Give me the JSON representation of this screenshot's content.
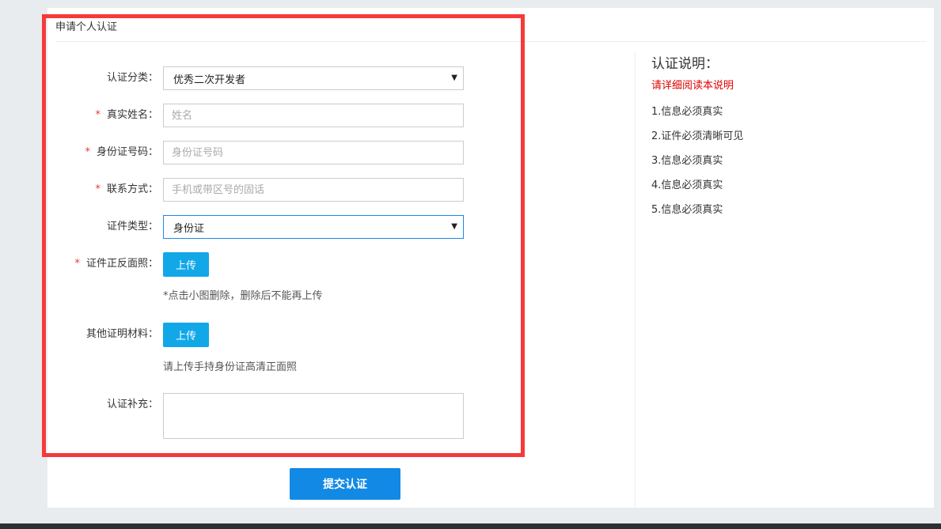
{
  "panel": {
    "title": "申请个人认证"
  },
  "form": {
    "category": {
      "label": "认证分类：",
      "value": "优秀二次开发者"
    },
    "realname": {
      "required_mark": "*",
      "label": "真实姓名：",
      "placeholder": "姓名"
    },
    "idnumber": {
      "required_mark": "*",
      "label": "身份证号码：",
      "placeholder": "身份证号码"
    },
    "contact": {
      "required_mark": "*",
      "label": "联系方式：",
      "placeholder": "手机或带区号的固话"
    },
    "doctype": {
      "label": "证件类型：",
      "value": "身份证"
    },
    "docphoto": {
      "required_mark": "*",
      "label": "证件正反面照：",
      "button": "上传",
      "hint": "*点击小图删除，删除后不能再上传"
    },
    "otherdocs": {
      "label": "其他证明材料：",
      "button": "上传",
      "hint": "请上传手持身份证高清正面照"
    },
    "supplement": {
      "label": "认证补充："
    },
    "submit": "提交认证"
  },
  "sidebar": {
    "title": "认证说明：",
    "subtitle": "请详细阅读本说明",
    "items": [
      "1.信息必须真实",
      "2.证件必须清晰可见",
      "3.信息必须真实",
      "4.信息必须真实",
      "5.信息必须真实"
    ]
  },
  "colors": {
    "accent": "#1289e5",
    "upload": "#12a8e8",
    "required": "#e53935",
    "highlight": "#f53a3a",
    "notice": "#e00000"
  },
  "icons": {
    "select_caret": "caret-down-icon"
  }
}
